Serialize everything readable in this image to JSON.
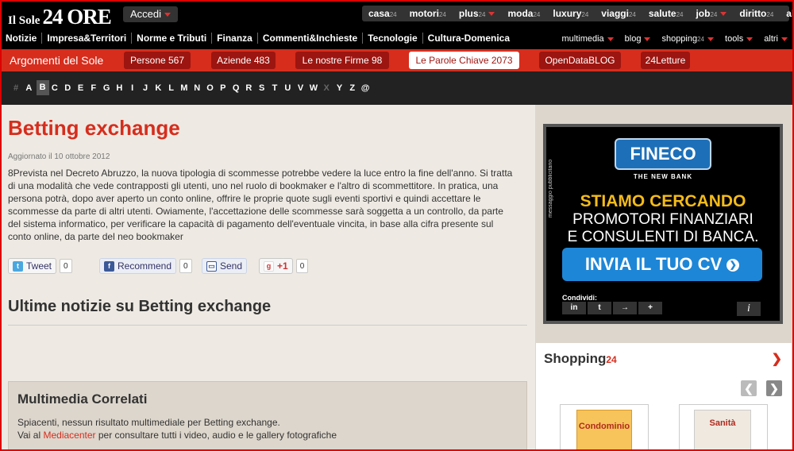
{
  "header": {
    "logo_small": "Il Sole",
    "logo_big": "24 ORE",
    "accedi": "Accedi",
    "top_sections": [
      {
        "label": "casa",
        "suffix": "24",
        "caret": false
      },
      {
        "label": "motori",
        "suffix": "24",
        "caret": false
      },
      {
        "label": "plus",
        "suffix": "24",
        "caret": true
      },
      {
        "label": "moda",
        "suffix": "24",
        "caret": false
      },
      {
        "label": "luxury",
        "suffix": "24",
        "caret": false
      },
      {
        "label": "viaggi",
        "suffix": "24",
        "caret": false
      },
      {
        "label": "salute",
        "suffix": "24",
        "caret": false
      },
      {
        "label": "job",
        "suffix": "24",
        "caret": true
      },
      {
        "label": "diritto",
        "suffix": "24",
        "caret": false
      },
      {
        "label": "altri",
        "suffix": "",
        "caret": true
      }
    ],
    "main_nav": [
      "Notizie",
      "Impresa&Territori",
      "Norme e Tributi",
      "Finanza",
      "Commenti&Inchieste",
      "Tecnologie",
      "Cultura-Domenica"
    ],
    "sub_nav": [
      {
        "label": "multimedia",
        "suffix": ""
      },
      {
        "label": "blog",
        "suffix": ""
      },
      {
        "label": "shopping",
        "suffix": "24"
      },
      {
        "label": "tools",
        "suffix": ""
      },
      {
        "label": "altri",
        "suffix": ""
      }
    ]
  },
  "topics": {
    "label": "Argomenti del Sole",
    "buttons": [
      {
        "label": "Persone 567",
        "active": false
      },
      {
        "label": "Aziende 483",
        "active": false
      },
      {
        "label": "Le nostre Firme 98",
        "active": false
      },
      {
        "label": "Le Parole Chiave 2073",
        "active": true
      },
      {
        "label": "OpenDataBLOG",
        "active": false
      },
      {
        "label": "24Letture",
        "active": false
      }
    ]
  },
  "alphabet": {
    "letters": [
      "#",
      "A",
      "B",
      "C",
      "D",
      "E",
      "F",
      "G",
      "H",
      "I",
      "J",
      "K",
      "L",
      "M",
      "N",
      "O",
      "P",
      "Q",
      "R",
      "S",
      "T",
      "U",
      "V",
      "W",
      "X",
      "Y",
      "Z",
      "@"
    ],
    "selected": "B",
    "disabled": [
      "#",
      "X"
    ]
  },
  "article": {
    "title": "Betting exchange",
    "updated": "Aggiornato il 10 ottobre 2012",
    "body": "8Prevista nel Decreto Abruzzo, la nuova tipologia di scommesse potrebbe vedere la luce entro la fine dell'anno. Si tratta di una modalità che vede contrapposti gli utenti, uno nel ruolo di bookmaker e l'altro di scommettitore. In pratica, una persona potrà, dopo aver aperto un conto online, offrire le proprie quote sugli eventi sportivi e quindi accettare le scommesse da parte di altri utenti. Owiamente, l'accettazione delle scommesse sarà soggetta a un controllo, da parte del sistema informatico, per verificare la capacità di pagamento dell'eventuale vincita, in base alla cifra presente sul conto online, da parte del neo bookmaker"
  },
  "share": {
    "tweet": "Tweet",
    "tweet_count": "0",
    "recommend": "Recommend",
    "recommend_count": "0",
    "send": "Send",
    "plusone": "+1",
    "plusone_count": "0"
  },
  "latest": {
    "heading": "Ultime notizie su Betting exchange"
  },
  "multimedia": {
    "title": "Multimedia Correlati",
    "line1": "Spiacenti, nessun risultato multimediale per Betting exchange.",
    "line2_pre": "Vai al ",
    "line2_link": "Mediacenter",
    "line2_post": " per consultare tutti i video, audio e le gallery fotografiche"
  },
  "ad": {
    "label": "messaggio pubblicitario",
    "brand": "FINECO",
    "tagline": "THE NEW BANK",
    "headline": "STIAMO CERCANDO",
    "line2": "PROMOTORI FINANZIARI",
    "line3": "E CONSULENTI DI BANCA.",
    "cta": "INVIA IL TUO CV",
    "share_label": "Condividi:",
    "share_icons": [
      "in",
      "t",
      "→",
      "+"
    ],
    "info": "i"
  },
  "shopping": {
    "title": "Shopping",
    "suffix": "24",
    "product1": "Condominio",
    "product2": "Sanità"
  },
  "colors": {
    "brand_red": "#d62d1d",
    "dark_red": "#9c1510",
    "header_black": "#000000"
  }
}
